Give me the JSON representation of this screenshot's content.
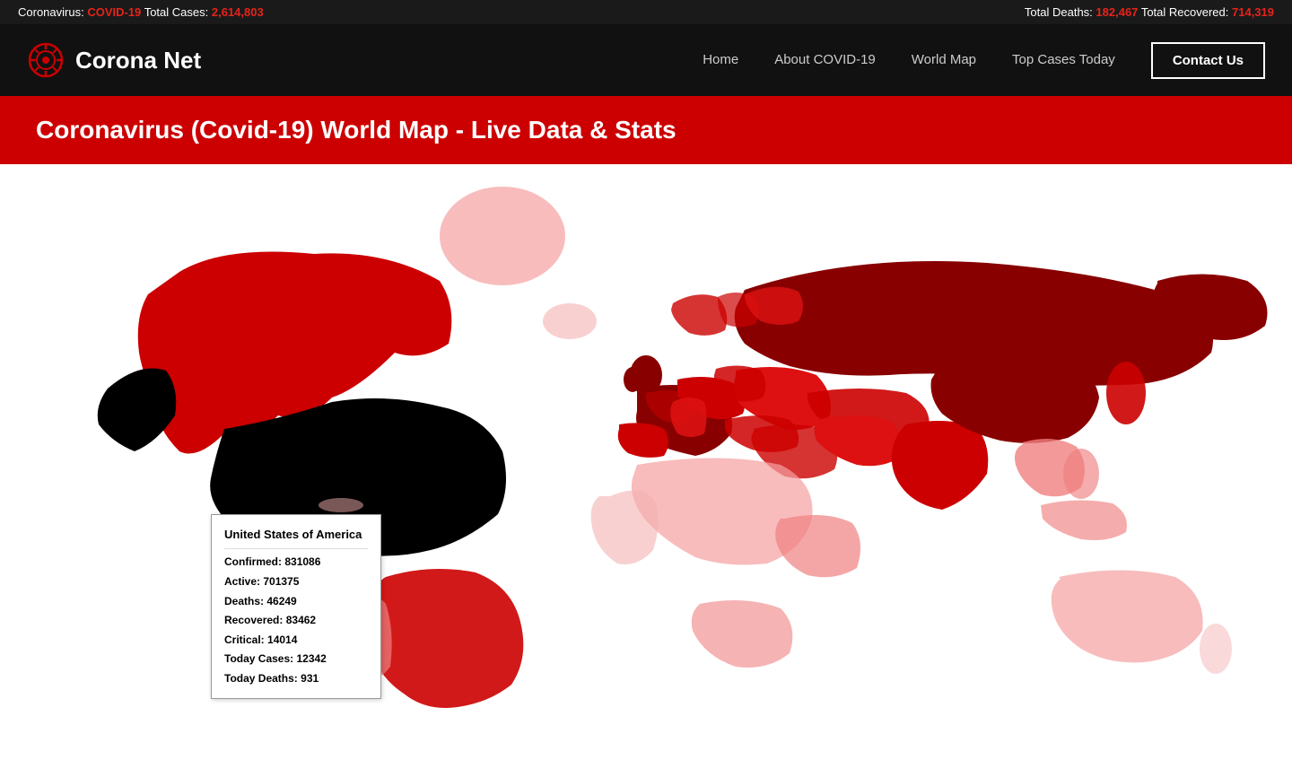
{
  "ticker": {
    "left_label": "Coronavirus:",
    "left_tag": "COVID-19",
    "left_text": "Total Cases:",
    "left_count": "2,614,803",
    "right_deaths_label": "Total Deaths:",
    "right_deaths_count": "182,467",
    "right_recovered_label": "Total Recovered:",
    "right_recovered_count": "714,319"
  },
  "logo": {
    "text": "Corona Net"
  },
  "nav": {
    "home": "Home",
    "about": "About COVID-19",
    "world_map": "World Map",
    "top_cases": "Top Cases Today",
    "contact": "Contact Us"
  },
  "banner": {
    "title": "Coronavirus (Covid-19) World Map - Live Data & Stats"
  },
  "tooltip": {
    "country": "United States of America",
    "confirmed_label": "Confirmed:",
    "confirmed_value": "831086",
    "active_label": "Active:",
    "active_value": "701375",
    "deaths_label": "Deaths:",
    "deaths_value": "46249",
    "recovered_label": "Recovered:",
    "recovered_value": "83462",
    "critical_label": "Critical:",
    "critical_value": "14014",
    "today_cases_label": "Today Cases:",
    "today_cases_value": "12342",
    "today_deaths_label": "Today Deaths:",
    "today_deaths_value": "931"
  }
}
